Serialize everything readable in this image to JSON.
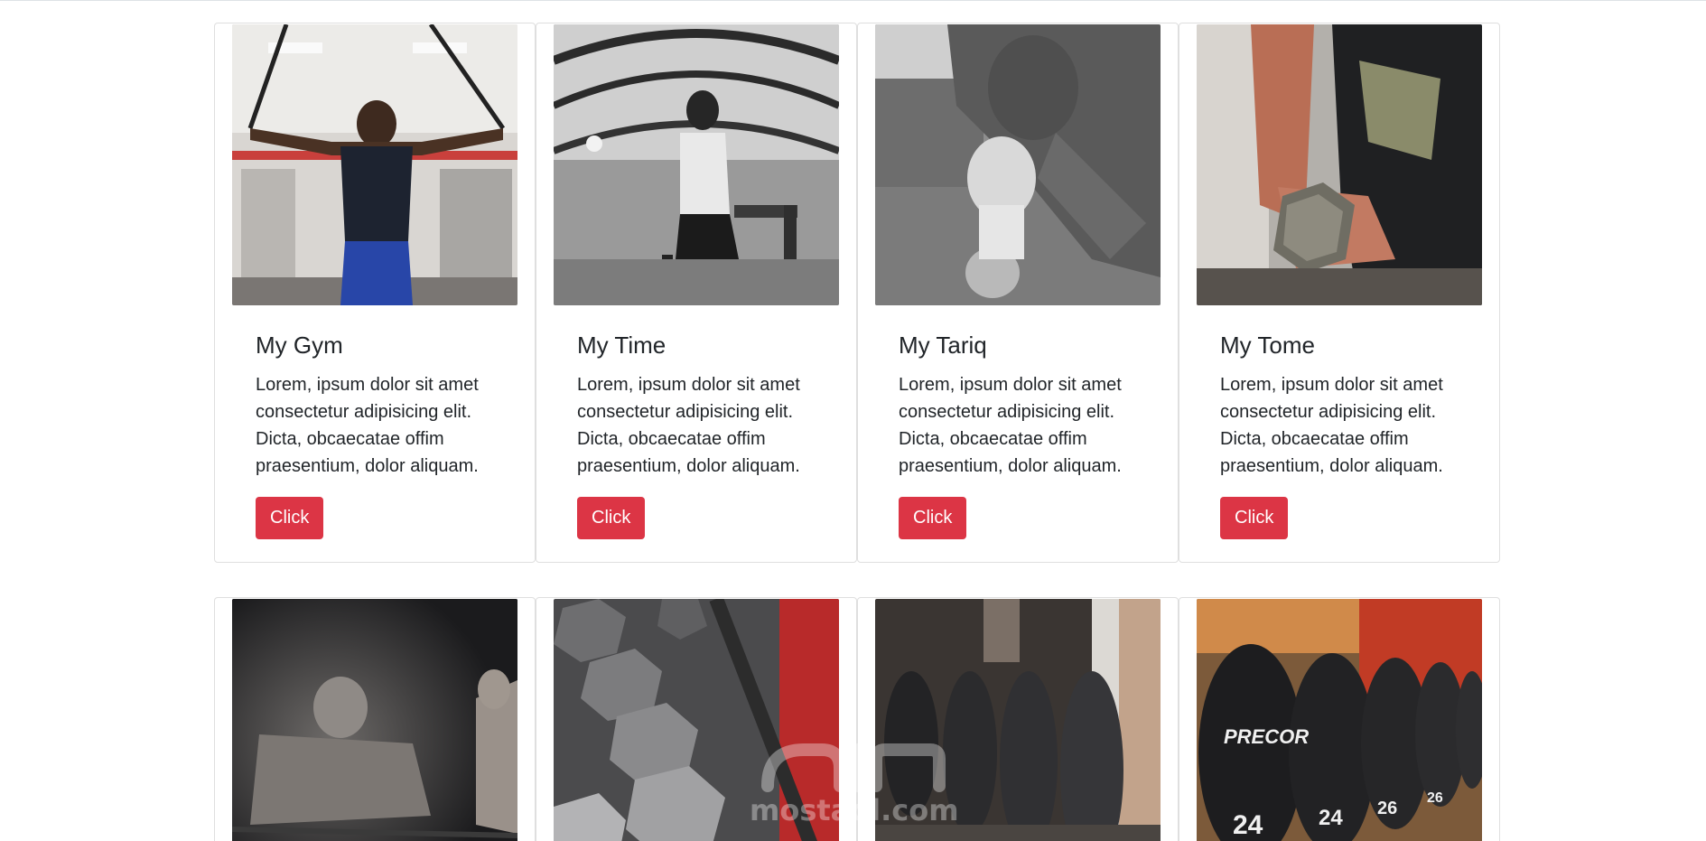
{
  "cards_row1": [
    {
      "title": "My Gym",
      "text": "Lorem, ipsum dolor sit amet consectetur adipisicing elit. Dicta, obcaecatae offim praesentium, dolor aliquam.",
      "button": "Click",
      "image": "gym-trainer-photo"
    },
    {
      "title": "My Time",
      "text": "Lorem, ipsum dolor sit amet consectetur adipisicing elit. Dicta, obcaecatae offim praesentium, dolor aliquam.",
      "button": "Click",
      "image": "spin-bike-photo"
    },
    {
      "title": "My Tariq",
      "text": "Lorem, ipsum dolor sit amet consectetur adipisicing elit. Dicta, obcaecatae offim praesentium, dolor aliquam.",
      "button": "Click",
      "image": "boxer-photo"
    },
    {
      "title": "My Tome",
      "text": "Lorem, ipsum dolor sit amet consectetur adipisicing elit. Dicta, obcaecatae offim praesentium, dolor aliquam.",
      "button": "Click",
      "image": "dumbbell-curl-photo"
    }
  ],
  "cards_row2": [
    {
      "image": "bodybuilder-photo"
    },
    {
      "image": "hex-dumbbell-rack-photo"
    },
    {
      "image": "dumbbell-rack-photo"
    },
    {
      "image": "precor-dumbbells-photo"
    }
  ],
  "watermark": {
    "text": "mostaql.com"
  },
  "colors": {
    "button": "#dc3545",
    "border": "#dee2e6",
    "text": "#212529"
  }
}
